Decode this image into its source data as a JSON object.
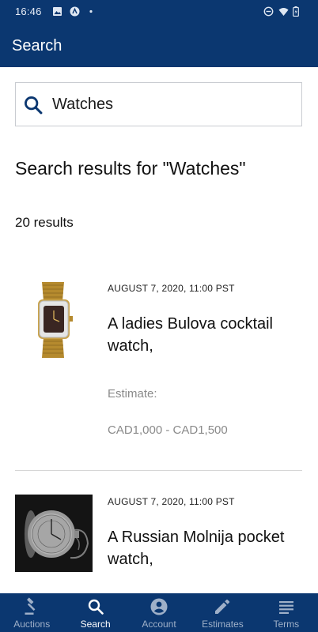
{
  "status_bar": {
    "time": "16:46"
  },
  "app_bar": {
    "title": "Search"
  },
  "search": {
    "value": "Watches"
  },
  "results": {
    "title": "Search results for \"Watches\"",
    "count": "20 results",
    "items": [
      {
        "date": "AUGUST 7, 2020, 11:00 PST",
        "name": "A ladies Bulova cocktail watch,",
        "estimate_label": "Estimate:",
        "estimate_value": "CAD1,000 - CAD1,500"
      },
      {
        "date": "AUGUST 7, 2020, 11:00 PST",
        "name": "A Russian Molnija pocket watch,"
      }
    ]
  },
  "bottom_nav": {
    "items": [
      {
        "label": "Auctions",
        "icon": "gavel-icon"
      },
      {
        "label": "Search",
        "icon": "search-icon",
        "active": true
      },
      {
        "label": "Account",
        "icon": "account-icon"
      },
      {
        "label": "Estimates",
        "icon": "pencil-icon"
      },
      {
        "label": "Terms",
        "icon": "list-icon"
      }
    ]
  },
  "colors": {
    "brand": "#0b3770",
    "muted_text": "#8a8a8a",
    "nav_inactive": "#9fb0c8"
  }
}
